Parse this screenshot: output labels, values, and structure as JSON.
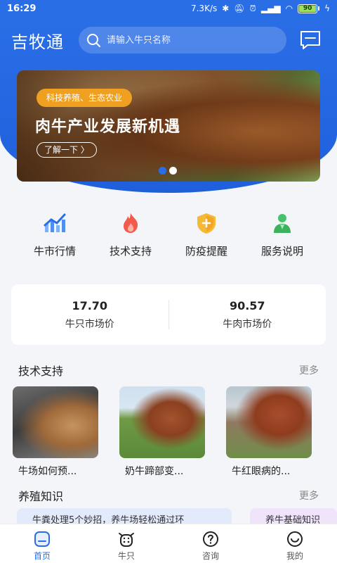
{
  "status_bar": {
    "time": "16:29",
    "speed": "7.3K/s",
    "battery": "90"
  },
  "header": {
    "app_title": "吉牧通",
    "search_placeholder": "请输入牛只名称"
  },
  "banner": {
    "tag": "科技养殖、生态农业",
    "headline": "肉牛产业发展新机遇",
    "more_label": "了解一下"
  },
  "quick_links": [
    {
      "label": "牛市行情",
      "icon": "trend-chart-icon"
    },
    {
      "label": "技术支持",
      "icon": "flame-icon"
    },
    {
      "label": "防疫提醒",
      "icon": "shield-plus-icon"
    },
    {
      "label": "服务说明",
      "icon": "person-badge-icon"
    }
  ],
  "prices": [
    {
      "value": "17.70",
      "caption": "牛只市场价"
    },
    {
      "value": "90.57",
      "caption": "牛肉市场价"
    }
  ],
  "tech_support": {
    "title": "技术支持",
    "more": "更多",
    "items": [
      {
        "caption": "牛场如何预..."
      },
      {
        "caption": "奶牛蹄部变..."
      },
      {
        "caption": "牛红眼病的..."
      }
    ]
  },
  "breeding_knowledge": {
    "title": "养殖知识",
    "more": "更多",
    "items": [
      {
        "text": "牛粪处理5个妙招，养牛场轻松通过环"
      },
      {
        "text": "养牛基础知识"
      }
    ]
  },
  "tabbar": [
    {
      "label": "首页",
      "icon": "home-icon",
      "active": true
    },
    {
      "label": "牛只",
      "icon": "cow-icon",
      "active": false
    },
    {
      "label": "咨询",
      "icon": "question-icon",
      "active": false
    },
    {
      "label": "我的",
      "icon": "smile-icon",
      "active": false
    }
  ],
  "colors": {
    "primary": "#2a6ee6",
    "tag": "#f0a020"
  }
}
